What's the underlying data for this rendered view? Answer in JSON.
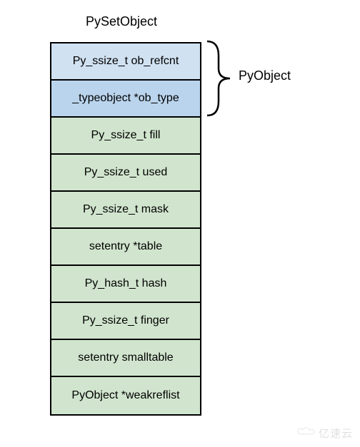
{
  "title": "PySetObject",
  "brace_label": "PyObject",
  "fields": [
    {
      "label": "Py_ssize_t ob_refcnt",
      "group": "header"
    },
    {
      "label": "_typeobject *ob_type",
      "group": "header"
    },
    {
      "label": "Py_ssize_t fill",
      "group": "body"
    },
    {
      "label": "Py_ssize_t used",
      "group": "body"
    },
    {
      "label": "Py_ssize_t mask",
      "group": "body"
    },
    {
      "label": "setentry *table",
      "group": "body"
    },
    {
      "label": "Py_hash_t hash",
      "group": "body"
    },
    {
      "label": "Py_ssize_t finger",
      "group": "body"
    },
    {
      "label": "setentry smalltable",
      "group": "body"
    },
    {
      "label": "PyObject *weakreflist",
      "group": "body"
    }
  ],
  "watermark": "亿速云"
}
